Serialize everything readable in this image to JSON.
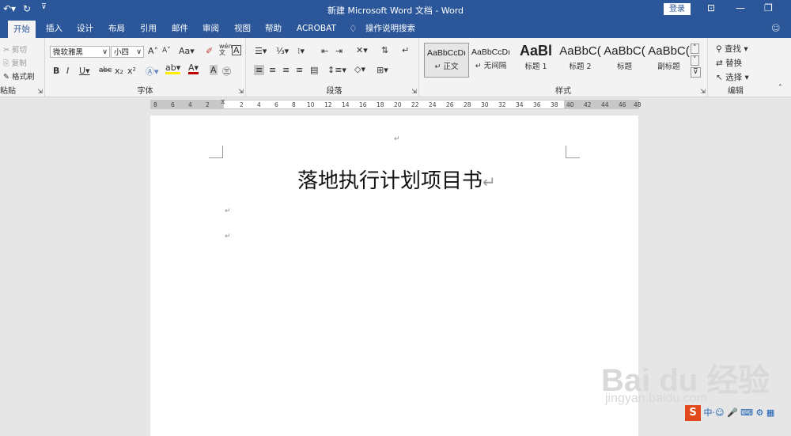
{
  "titlebar": {
    "title": "新建 Microsoft Word 文档  -  Word",
    "login": "登录"
  },
  "tabs": [
    "开始",
    "插入",
    "设计",
    "布局",
    "引用",
    "邮件",
    "审阅",
    "视图",
    "帮助",
    "ACROBAT",
    "操作说明搜索"
  ],
  "clipboard": {
    "cut": "剪切",
    "copy": "复制",
    "painter": "格式刷",
    "label": "粘贴"
  },
  "font": {
    "name": "微软雅黑",
    "size": "小四",
    "label": "字体",
    "wen": "wén",
    "A": "A",
    "aa": "Aa"
  },
  "paragraph": {
    "label": "段落"
  },
  "styles": {
    "label": "样式",
    "items": [
      {
        "sample": "AaBbCcDı",
        "name": "↵ 正文"
      },
      {
        "sample": "AaBbCcDı",
        "name": "↵ 无间隔"
      },
      {
        "sample": "AaBl",
        "name": "标题 1"
      },
      {
        "sample": "AaBbC(",
        "name": "标题 2"
      },
      {
        "sample": "AaBbC(",
        "name": "标题"
      },
      {
        "sample": "AaBbC(",
        "name": "副标题"
      }
    ]
  },
  "editing": {
    "find": "查找",
    "replace": "替换",
    "select": "选择",
    "label": "编辑"
  },
  "ruler": {
    "left": [
      "8",
      "6",
      "4",
      "2"
    ],
    "right": [
      "2",
      "4",
      "6",
      "8",
      "10",
      "12",
      "14",
      "16",
      "18",
      "20",
      "22",
      "24",
      "26",
      "28",
      "30",
      "32",
      "34",
      "36",
      "38",
      "40",
      "42",
      "44",
      "46",
      "48"
    ]
  },
  "document": {
    "title": "落地执行计划项目书",
    "para_mark": "↵"
  },
  "watermark": {
    "brand": "Bai du 经验",
    "url": "jingyan.baidu.com"
  },
  "colors": {
    "brand": "#2b579a",
    "ribbon": "#f3f3f3",
    "canvas": "#e6e6e6"
  }
}
